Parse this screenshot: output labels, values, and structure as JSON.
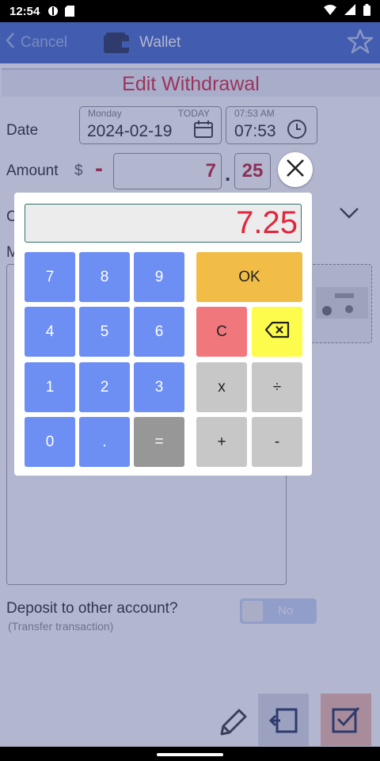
{
  "status_bar": {
    "time": "12:54"
  },
  "app_bar": {
    "cancel_label": "Cancel",
    "title": "Wallet"
  },
  "form": {
    "header": "Edit Withdrawal",
    "date_label": "Date",
    "day_name": "Monday",
    "today_label": "TODAY",
    "date_value": "2024-02-19",
    "time_small": "07:53 AM",
    "time_value": "07:53",
    "amount_label": "Amount",
    "currency_symbol": "$",
    "sign": "-",
    "amount_whole": "7",
    "decimal_point": ".",
    "amount_cents": "25",
    "category_letter": "C",
    "memo_letter": "M",
    "deposit_question": "Deposit to other account?",
    "deposit_hint": "(Transfer transaction)",
    "toggle_label": "No"
  },
  "calculator": {
    "display": "7.25",
    "keys": {
      "seven": "7",
      "eight": "8",
      "nine": "9",
      "four": "4",
      "five": "5",
      "six": "6",
      "one": "1",
      "two": "2",
      "three": "3",
      "zero": "0",
      "dot": ".",
      "equals": "=",
      "ok": "OK",
      "clear": "C",
      "multiply": "x",
      "divide": "÷",
      "plus": "+",
      "minus": "-"
    }
  },
  "colors": {
    "app_bar": "#3f67c9",
    "accent_red": "#d8203a",
    "num_key": "#6d8ff3",
    "ok_key": "#f2bd46",
    "clear_key": "#f0787c",
    "backspace_key": "#fdfb4c",
    "op_key": "#c7c7c7",
    "equals_key": "#979797"
  },
  "icons": [
    "wallet-icon",
    "star-icon",
    "calendar-icon",
    "clock-icon",
    "chevron-down-icon",
    "close-icon",
    "backspace-icon",
    "pencil-icon",
    "undo-icon",
    "checkbox-icon"
  ]
}
